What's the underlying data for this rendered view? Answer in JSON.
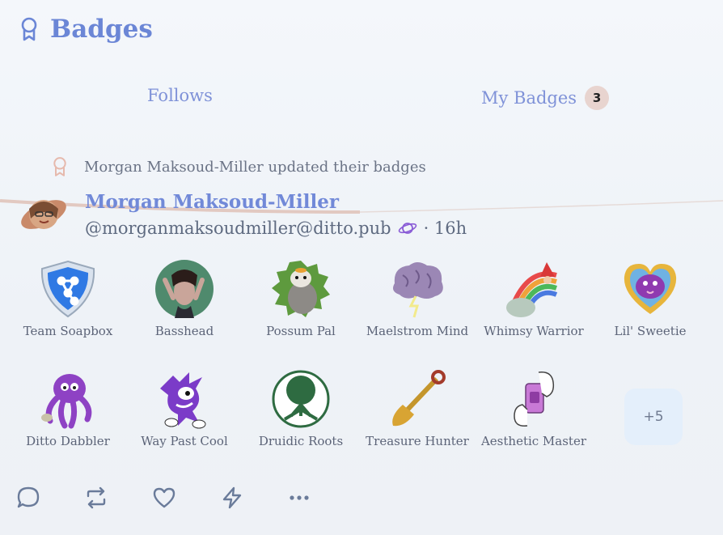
{
  "header": {
    "title": "Badges",
    "icon": "award-icon"
  },
  "tabs": [
    {
      "label": "Follows",
      "active": true
    },
    {
      "label": "My Badges",
      "count": "3",
      "active": false
    }
  ],
  "activity": {
    "text": "Morgan Maksoud-Miller updated their badges",
    "icon": "award-icon"
  },
  "user": {
    "name": "Morgan Maksoud-Miller",
    "handle": "@morganmaksoudmiller@ditto.pub",
    "time": "· 16h"
  },
  "badges": [
    {
      "label": "Team Soapbox",
      "icon": "soapbox-shield-icon"
    },
    {
      "label": "Basshead",
      "icon": "basshead-portrait-icon"
    },
    {
      "label": "Possum Pal",
      "icon": "possum-icon"
    },
    {
      "label": "Maelstrom Mind",
      "icon": "brain-storm-icon"
    },
    {
      "label": "Whimsy Warrior",
      "icon": "rainbow-gnome-icon"
    },
    {
      "label": "Lil' Sweetie",
      "icon": "heart-bird-icon"
    },
    {
      "label": "Ditto Dabbler",
      "icon": "purple-octopus-icon"
    },
    {
      "label": "Way Past Cool",
      "icon": "purple-creature-icon"
    },
    {
      "label": "Druidic Roots",
      "icon": "tree-of-life-icon"
    },
    {
      "label": "Treasure Hunter",
      "icon": "golden-shovel-icon"
    },
    {
      "label": "Aesthetic Master",
      "icon": "hands-phone-icon"
    }
  ],
  "more": {
    "label": "+5"
  },
  "actions": [
    "reply-icon",
    "repost-icon",
    "like-icon",
    "zap-icon",
    "more-icon"
  ],
  "colors": {
    "accent": "#6b86d6",
    "tab_underline": "#e2c9c1",
    "badge_bg": "#e8d4cf"
  }
}
